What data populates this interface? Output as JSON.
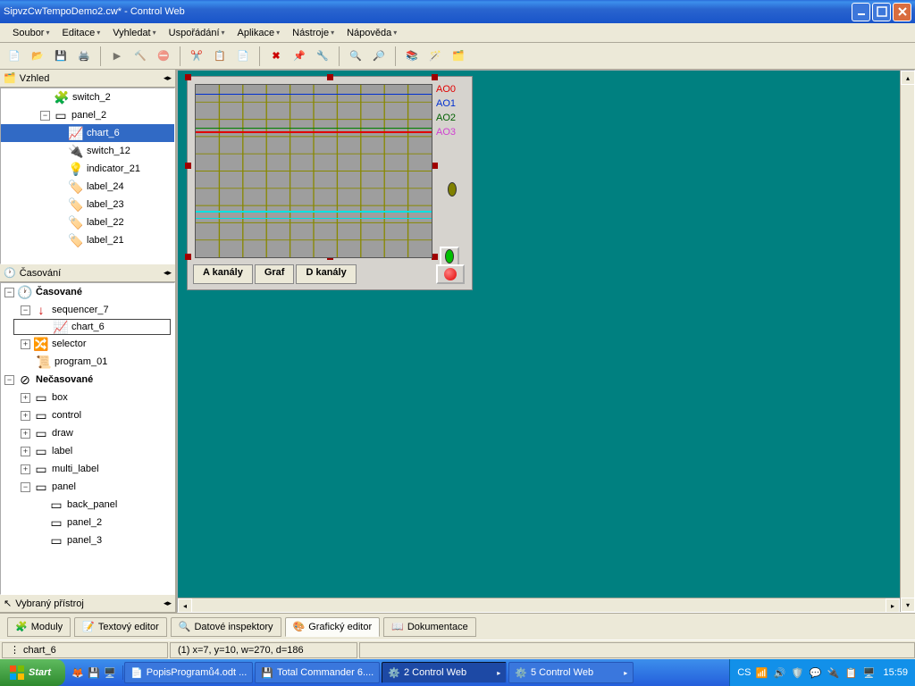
{
  "window": {
    "title": "SipvzCwTempoDemo2.cw* - Control Web"
  },
  "menu": {
    "items": [
      "Soubor",
      "Editace",
      "Vyhledat",
      "Uspořádání",
      "Aplikace",
      "Nástroje",
      "Nápověda"
    ]
  },
  "left_top_panel": {
    "title": "Vzhled"
  },
  "tree_top": {
    "switch2": "switch_2",
    "panel2": "panel_2",
    "chart6": "chart_6",
    "switch12": "switch_12",
    "indicator21": "indicator_21",
    "label24": "label_24",
    "label23": "label_23",
    "label22": "label_22",
    "label21": "label_21"
  },
  "left_mid_panel": {
    "title": "Časování"
  },
  "tree_mid": {
    "casovane": "Časované",
    "sequencer7": "sequencer_7",
    "chart6": "chart_6",
    "selector": "selector",
    "program01": "program_01",
    "necasovane": "Nečasované",
    "box": "box",
    "control": "control",
    "draw": "draw",
    "label": "label",
    "multilabel": "multi_label",
    "panel": "panel",
    "backpanel": "back_panel",
    "panel2": "panel_2",
    "panel3": "panel_3"
  },
  "left_bottom_panel": {
    "title": "Vybraný přístroj"
  },
  "chart": {
    "labels": [
      "AO0",
      "AO1",
      "AO2",
      "AO3"
    ],
    "tabs": {
      "a": "A kanály",
      "g": "Graf",
      "d": "D kanály"
    }
  },
  "bottom_tabs": {
    "moduly": "Moduly",
    "textovy": "Textový editor",
    "datove": "Datové inspektory",
    "graficky": "Grafický editor",
    "dokumentace": "Dokumentace"
  },
  "status": {
    "sel": "chart_6",
    "pos": "(1) x=7, y=10, w=270, d=186"
  },
  "taskbar": {
    "start": "Start",
    "item1": "PopisProgramů4.odt ...",
    "item2": "Total Commander 6....",
    "item3": "2  Control Web",
    "item4": "5  Control Web",
    "lang": "CS",
    "clock": "15:59"
  },
  "chart_data": {
    "type": "line",
    "title": "",
    "xlabel": "",
    "ylabel": "",
    "xlim": [
      0,
      10
    ],
    "ylim": [
      0,
      10
    ],
    "series": [
      {
        "name": "AO0",
        "color": "#e00000",
        "values": [
          6.0,
          6.0,
          6.0,
          6.0,
          6.0,
          6.0,
          6.0,
          6.0,
          6.0,
          6.0
        ]
      },
      {
        "name": "AO1",
        "color": "#0030d0",
        "values": [
          9.5,
          9.5,
          9.5,
          9.5,
          9.5,
          9.5,
          9.5,
          9.5,
          9.5,
          9.5
        ]
      },
      {
        "name": "AO2",
        "color": "#008000",
        "values": [
          7.5,
          7.5,
          7.5,
          7.5,
          7.5,
          7.5,
          7.5,
          7.5,
          7.5,
          7.5
        ]
      },
      {
        "name": "AO3",
        "color": "#00e0e0",
        "values": [
          2.3,
          2.3,
          2.3,
          2.3,
          2.3,
          2.3,
          2.3,
          2.3,
          2.3,
          2.3
        ]
      }
    ]
  }
}
